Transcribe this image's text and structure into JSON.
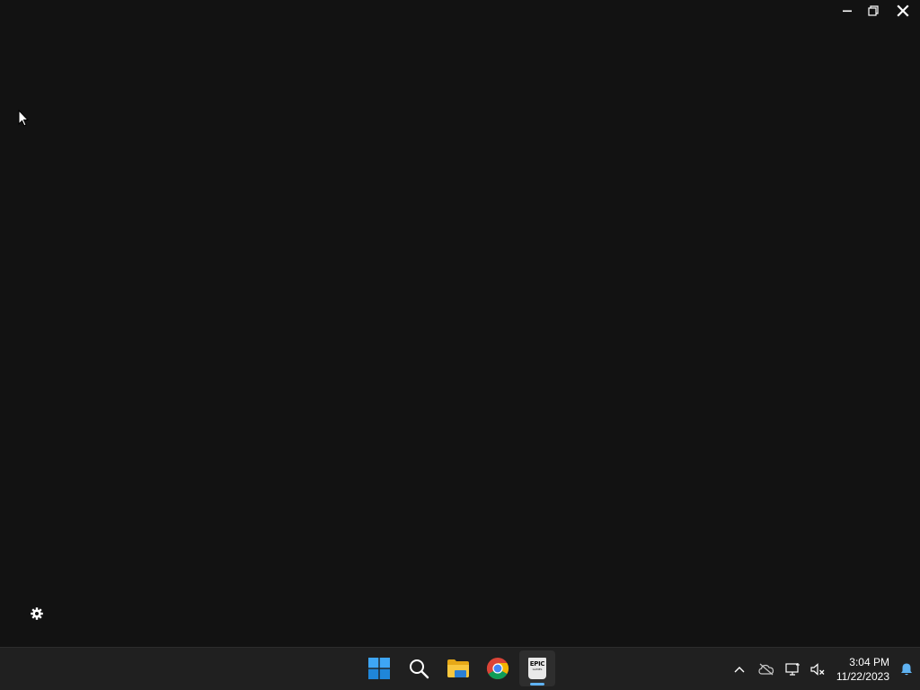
{
  "window": {
    "controls": {
      "minimize": "minimize-icon",
      "restore": "restore-icon",
      "close": "close-icon"
    },
    "background": "#121212"
  },
  "launcher": {
    "settings_icon": "gear-icon"
  },
  "taskbar": {
    "apps": [
      {
        "name": "Start",
        "icon": "windows-start-icon",
        "active": false
      },
      {
        "name": "Search",
        "icon": "search-icon",
        "active": false
      },
      {
        "name": "File Explorer",
        "icon": "folder-icon",
        "active": false
      },
      {
        "name": "Google Chrome",
        "icon": "chrome-icon",
        "active": false
      },
      {
        "name": "Epic Games Launcher",
        "icon": "epic-games-icon",
        "active": true,
        "logo_text": "EPIC",
        "logo_subtext": "GAMES"
      }
    ],
    "tray": {
      "icons": [
        "chevron-up-icon",
        "onedrive-offline-icon",
        "network-icon",
        "volume-muted-icon",
        "notification-bell-icon"
      ],
      "time": "3:04 PM",
      "date": "11/22/2023"
    },
    "accent": "#5fb2f2"
  }
}
